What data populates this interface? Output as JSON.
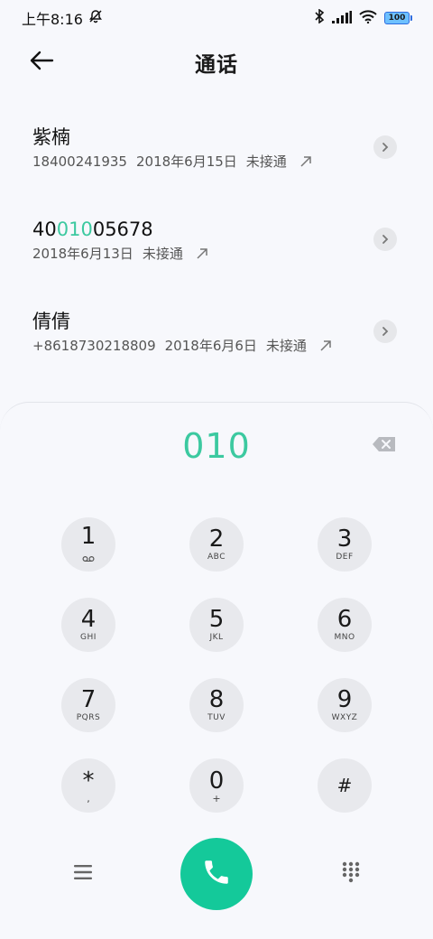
{
  "status_bar": {
    "time": "上午8:16",
    "battery": "100",
    "icons": [
      "alarm-off-icon",
      "bluetooth-icon",
      "signal-icon",
      "wifi-icon",
      "battery-icon"
    ]
  },
  "header": {
    "title": "通话",
    "back_icon": "arrow-left-icon"
  },
  "calls": [
    {
      "name": "紫楠",
      "name_parts": [
        "紫楠",
        "",
        ""
      ],
      "number": "18400241935",
      "date": "2018年6月15日",
      "status": "未接通"
    },
    {
      "name": "4001005678",
      "name_parts": [
        "40",
        "010",
        "05678"
      ],
      "number": "",
      "date": "2018年6月13日",
      "status": "未接通"
    },
    {
      "name": "倩倩",
      "name_parts": [
        "倩倩",
        "",
        ""
      ],
      "number": "+8618730218809",
      "date": "2018年6月6日",
      "status": "未接通"
    }
  ],
  "dialpad": {
    "input": "010",
    "keys": [
      {
        "digit": "1",
        "letters": "",
        "icon": "voicemail-icon"
      },
      {
        "digit": "2",
        "letters": "ABC"
      },
      {
        "digit": "3",
        "letters": "DEF"
      },
      {
        "digit": "4",
        "letters": "GHI"
      },
      {
        "digit": "5",
        "letters": "JKL"
      },
      {
        "digit": "6",
        "letters": "MNO"
      },
      {
        "digit": "7",
        "letters": "PQRS"
      },
      {
        "digit": "8",
        "letters": "TUV"
      },
      {
        "digit": "9",
        "letters": "WXYZ"
      },
      {
        "digit": "*",
        "letters": ","
      },
      {
        "digit": "0",
        "letters": "+"
      },
      {
        "digit": "#",
        "letters": ""
      }
    ]
  },
  "colors": {
    "accent": "#3cc9a0",
    "call_button": "#14c99a",
    "key_bg": "#e8e9ed",
    "background": "#f7f8fc"
  }
}
